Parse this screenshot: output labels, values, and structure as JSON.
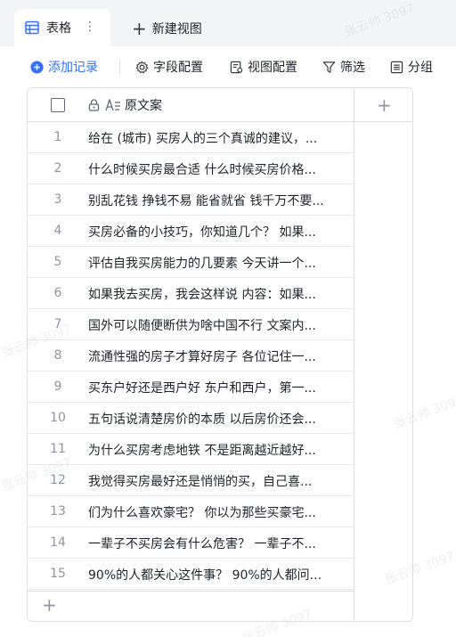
{
  "tabs": {
    "active_label": "表格",
    "more_glyph": "⋮",
    "new_view_label": "新建视图"
  },
  "toolbar": {
    "add_record": "添加记录",
    "field_config": "字段配置",
    "view_config": "视图配置",
    "filter": "筛选",
    "group": "分组"
  },
  "table": {
    "column_header": "原文案",
    "rows": [
      {
        "num": "1",
        "text": "给在 (城市) 买房人的三个真诚的建议，..."
      },
      {
        "num": "2",
        "text": "什么时候买房最合适 什么时候买房价格..."
      },
      {
        "num": "3",
        "text": "别乱花钱 挣钱不易 能省就省 钱千万不要..."
      },
      {
        "num": "4",
        "text": "买房必备的小技巧，你知道几个？ 如果..."
      },
      {
        "num": "5",
        "text": "评估自我买房能力的几要素 今天讲一个..."
      },
      {
        "num": "6",
        "text": "如果我去买房，我会这样说 内容：如果..."
      },
      {
        "num": "7",
        "text": "国外可以随便断供为啥中国不行 文案内..."
      },
      {
        "num": "8",
        "text": "流通性强的房子才算好房子 各位记住一..."
      },
      {
        "num": "9",
        "text": "买东户好还是西户好 东户和西户，第一..."
      },
      {
        "num": "10",
        "text": "五句话说清楚房价的本质 以后房价还会..."
      },
      {
        "num": "11",
        "text": "为什么买房考虑地铁 不是距离越近越好..."
      },
      {
        "num": "12",
        "text": "我觉得买房最好还是悄悄的买，自己喜..."
      },
      {
        "num": "13",
        "text": "们为什么喜欢豪宅？ 你以为那些买豪宅..."
      },
      {
        "num": "14",
        "text": "一辈子不买房会有什么危害？ 一辈子不..."
      },
      {
        "num": "15",
        "text": "90%的人都关心这件事？ 90%的人都问..."
      }
    ]
  },
  "watermark": "张云帅 3097",
  "colors": {
    "accent": "#3370ff",
    "border": "#dee0e3",
    "muted_text": "#8f959e"
  }
}
